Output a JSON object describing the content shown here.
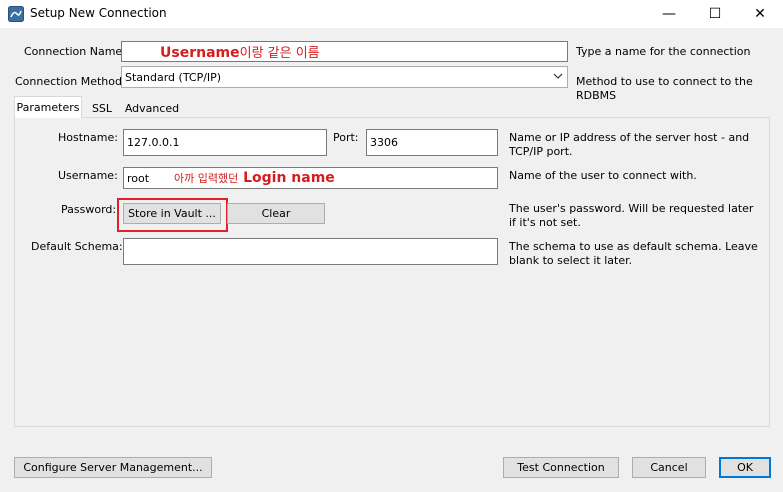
{
  "window": {
    "title": "Setup New Connection",
    "minimize": "—",
    "maximize": "☐",
    "close": "✕"
  },
  "connection_name": {
    "label": "Connection Name:",
    "annotation_bold": "Username",
    "annotation_rest": "이랑 같은 이름",
    "help": "Type a name for the connection"
  },
  "connection_method": {
    "label": "Connection Method:",
    "value": "Standard (TCP/IP)",
    "help": "Method to use to connect to the RDBMS"
  },
  "tabs": [
    {
      "label": "Parameters"
    },
    {
      "label": "SSL"
    },
    {
      "label": "Advanced"
    }
  ],
  "hostname": {
    "label": "Hostname:",
    "value": "127.0.0.1"
  },
  "port": {
    "label": "Port:",
    "value": "3306",
    "help": "Name or IP address of the server host - and TCP/IP port."
  },
  "username": {
    "label": "Username:",
    "value": "root",
    "annotation_korean": "아까 입력했던",
    "annotation_bold": "Login name",
    "help": "Name of the user to connect with."
  },
  "password": {
    "label": "Password:",
    "store_button": "Store in Vault ...",
    "clear_button": "Clear",
    "help": "The user's password. Will be requested later if it's not set."
  },
  "default_schema": {
    "label": "Default Schema:",
    "value": "",
    "help": "The schema to use as default schema. Leave blank to select it later."
  },
  "footer": {
    "configure_button": "Configure Server Management...",
    "test_button": "Test Connection",
    "cancel_button": "Cancel",
    "ok_button": "OK"
  }
}
